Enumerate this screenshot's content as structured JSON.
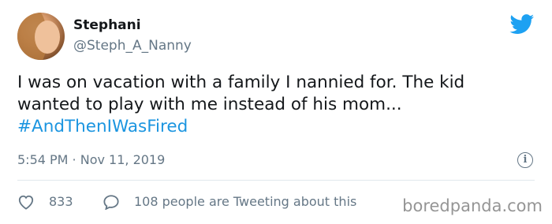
{
  "user": {
    "name": "Stephani",
    "handle": "@Steph_A_Nanny"
  },
  "tweet": {
    "line1": "I was on vacation with a family I nannied for. The kid",
    "line2": "wanted to play with me instead of his mom...",
    "hashtag": "#AndThenIWasFired"
  },
  "meta": {
    "timestamp": "5:54 PM · Nov 11, 2019",
    "info_icon": "info-icon"
  },
  "actions": {
    "like_icon": "heart-icon",
    "like_count": "833",
    "reply_icon": "speech-bubble-icon",
    "tweeting_text": "108 people are Tweeting about this"
  },
  "watermark": "boredpanda.com",
  "colors": {
    "text": "#14171a",
    "secondary": "#657786",
    "hashtag": "#1b95e0",
    "twitter_blue": "#1da1f2",
    "divider": "#e1e8ed"
  }
}
